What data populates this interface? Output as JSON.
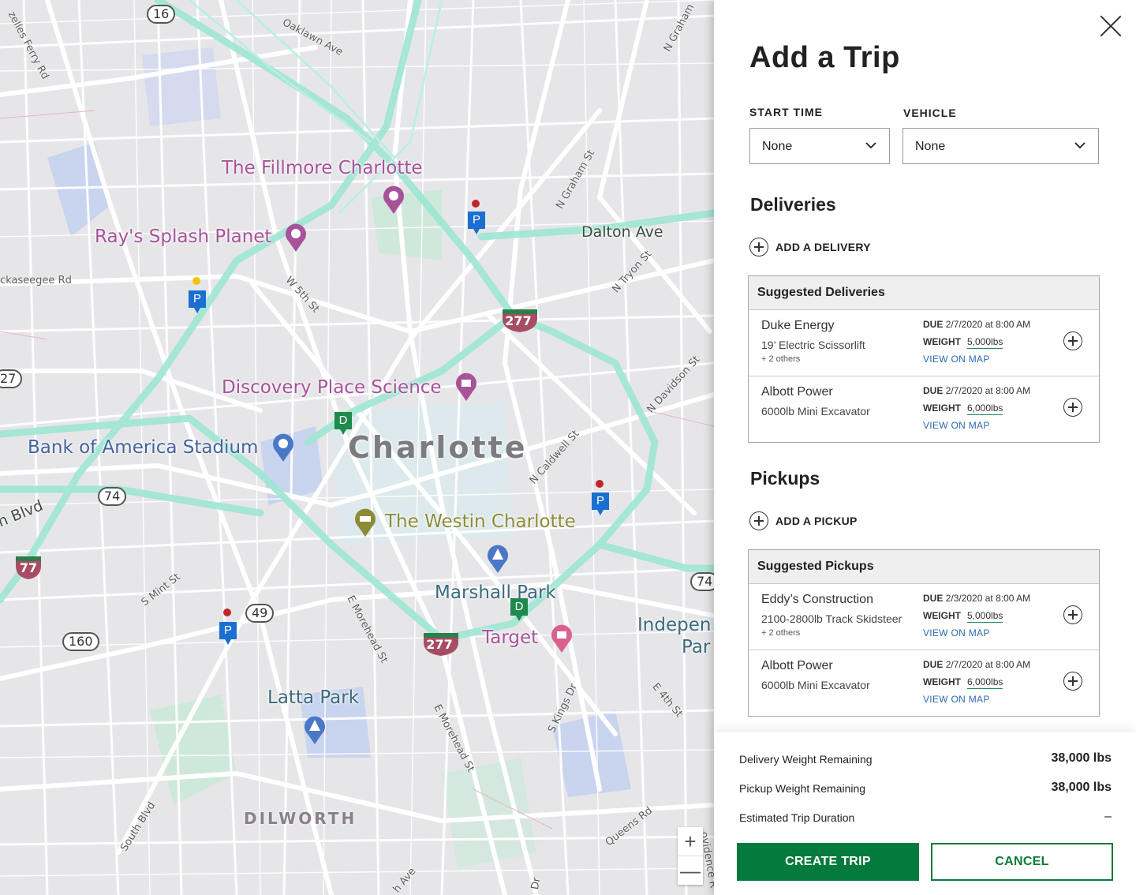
{
  "map": {
    "labels": {
      "fillmore": "The Fillmore Charlotte",
      "rays": "Ray's Splash Planet",
      "discovery": "Discovery Place Science",
      "boa": "Bank of America Stadium",
      "charlotte": "Charlotte",
      "westin": "The Westin Charlotte",
      "marshall": "Marshall Park",
      "target": "Target",
      "latta": "Latta Park",
      "dilworth": "DILWORTH",
      "indep1": "Indepen",
      "indep2": "Par",
      "dalton": "Dalton Ave",
      "oaklawn": "Oaklawn Ave",
      "ngraham_top": "N Graham",
      "ngraham": "N Graham St",
      "ntryon": "N Tryon St",
      "ndavidson": "N Davidson St",
      "ncaldwell": "N Caldwell St",
      "w5th": "W 5th St",
      "smint": "S Mint St",
      "emorehead1": "E Morehead St",
      "emorehead2": "E Morehead St",
      "skings": "S Kings Dr",
      "e4th": "E 4th St",
      "queens": "Queens Rd",
      "southblvd": "South Blvd",
      "freedom": "ckaseegee Rd",
      "ferry": "zelles Ferry Rd",
      "blvd": "n Blvd",
      "ave_bottom": "h Ave",
      "dr_bottom": "Dr",
      "providence": "ovidence R"
    },
    "shields": {
      "s16": "16",
      "s27": "27",
      "s74": "74",
      "s49": "49",
      "s160": "160",
      "s74r": "74"
    },
    "interstates": {
      "i277a": "277",
      "i277b": "277",
      "i77": "77"
    },
    "pins": {
      "parking": "P",
      "delivery": "D"
    },
    "zoom": {
      "in": "+",
      "out": "—"
    },
    "colors": {
      "highway": "#9ee6d3",
      "road": "#ffffff",
      "park": "#cfe8dc",
      "water": "#c9d4ee"
    }
  },
  "panel": {
    "title": "Add a Trip",
    "start_time_label": "START TIME",
    "start_time_value": "None",
    "vehicle_label": "VEHICLE",
    "vehicle_value": "None",
    "deliveries_title": "Deliveries",
    "add_delivery": "ADD A DELIVERY",
    "suggested_deliveries_title": "Suggested Deliveries",
    "deliveries": [
      {
        "name": "Duke Energy",
        "desc": "19’ Electric Scissorlift",
        "others": "+ 2 others",
        "due_label": "DUE",
        "due": "2/7/2020 at 8:00 AM",
        "weight_label": "WEIGHT",
        "weight": "5,000lbs",
        "view": "VIEW ON MAP"
      },
      {
        "name": "Albott Power",
        "desc": "6000lb Mini Excavator",
        "others": "",
        "due_label": "DUE",
        "due": "2/7/2020 at 8:00 AM",
        "weight_label": "WEIGHT",
        "weight": "6,000lbs",
        "view": "VIEW ON MAP"
      }
    ],
    "pickups_title": "Pickups",
    "add_pickup": "ADD A PICKUP",
    "suggested_pickups_title": "Suggested Pickups",
    "pickups": [
      {
        "name": "Eddy’s Construction",
        "desc": "2100-2800lb Track Skidsteer",
        "others": "+ 2 others",
        "due_label": "DUE",
        "due": "2/3/2020 at 8:00 AM",
        "weight_label": "WEIGHT",
        "weight": "5,000lbs",
        "view": "VIEW ON MAP"
      },
      {
        "name": "Albott Power",
        "desc": "6000lb Mini Excavator",
        "others": "",
        "due_label": "DUE",
        "due": "2/7/2020 at 8:00 AM",
        "weight_label": "WEIGHT",
        "weight": "6,000lbs",
        "view": "VIEW ON MAP"
      }
    ],
    "footer": {
      "delivery_remaining_label": "Delivery Weight Remaining",
      "delivery_remaining_value": "38,000 lbs",
      "pickup_remaining_label": "Pickup Weight Remaining",
      "pickup_remaining_value": "38,000 lbs",
      "duration_label": "Estimated Trip Duration",
      "duration_value": "–",
      "create_label": "CREATE TRIP",
      "cancel_label": "CANCEL"
    },
    "colors": {
      "primary": "#047a3c",
      "link": "#2d6bb2"
    }
  }
}
